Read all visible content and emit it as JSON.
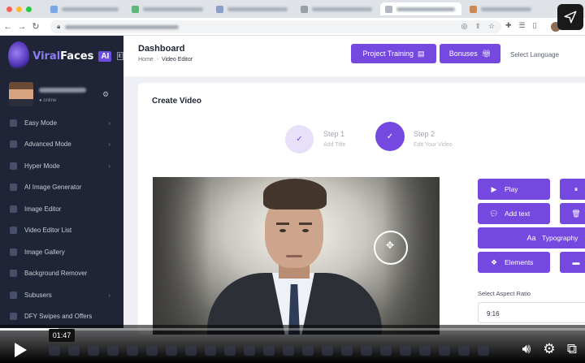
{
  "browser": {
    "tab_count": 6,
    "active_tab_index": 4
  },
  "app": {
    "brand_prefix": "Viral",
    "brand_suffix": "Faces",
    "brand_badge": "AI",
    "user_status": "● online"
  },
  "sidebar": {
    "items": [
      {
        "label": "Easy Mode",
        "has_children": true
      },
      {
        "label": "Advanced Mode",
        "has_children": true
      },
      {
        "label": "Hyper Mode",
        "has_children": true
      },
      {
        "label": "AI Image Generator",
        "has_children": false
      },
      {
        "label": "Image Editor",
        "has_children": false
      },
      {
        "label": "Video Editor List",
        "has_children": false
      },
      {
        "label": "Image Gallery",
        "has_children": false
      },
      {
        "label": "Background Remover",
        "has_children": false
      },
      {
        "label": "Subusers",
        "has_children": true
      },
      {
        "label": "DFY Swipes and Offers",
        "has_children": false
      }
    ]
  },
  "header": {
    "title": "Dashboard",
    "breadcrumb_home": "Home",
    "breadcrumb_separator": "-",
    "breadcrumb_current": "Video Editor",
    "project_training_label": "Project Training",
    "bonuses_label": "Bonuses",
    "select_language_label": "Select Language"
  },
  "content": {
    "card_title": "Create Video",
    "steps": [
      {
        "title": "Step 1",
        "subtitle": "Add Title",
        "state": "done"
      },
      {
        "title": "Step 2",
        "subtitle": "Edit Your Video",
        "state": "active"
      }
    ],
    "actions": {
      "play": "Play",
      "add_text": "Add text",
      "typography": "Typography",
      "elements": "Elements"
    },
    "aspect_ratio_label": "Select Aspect Ratio",
    "aspect_ratio_value": "9:16"
  },
  "player": {
    "current_time": "01:47",
    "progress_fraction": 0.1
  },
  "colors": {
    "accent": "#7548df",
    "sidebar_bg": "#1f2537",
    "step_done_bg": "#e7e0f8"
  }
}
